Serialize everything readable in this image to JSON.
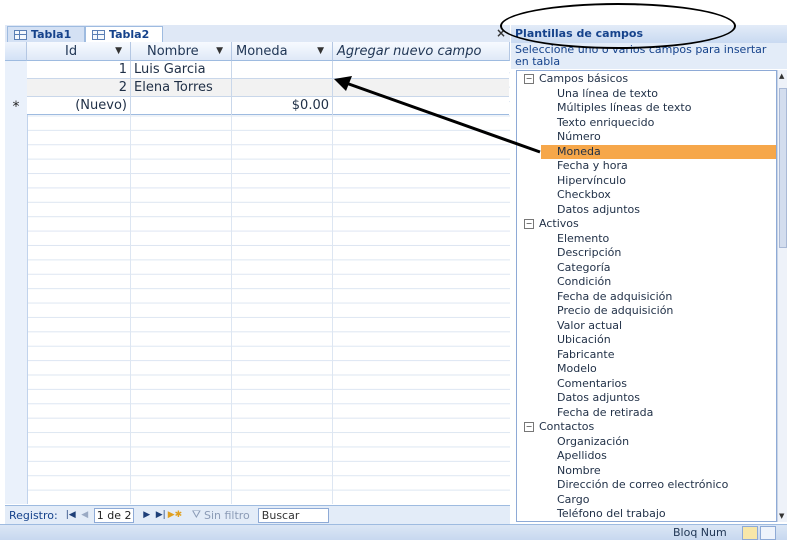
{
  "tabs": [
    {
      "label": "Tabla1"
    },
    {
      "label": "Tabla2"
    }
  ],
  "tab_close_glyph": "×",
  "datasheet": {
    "columns": [
      "Id",
      "Nombre",
      "Moneda",
      "Agregar nuevo campo"
    ],
    "rows": [
      {
        "id": "1",
        "nombre": "Luis Garcia",
        "moneda": ""
      },
      {
        "id": "2",
        "nombre": "Elena Torres",
        "moneda": ""
      }
    ],
    "new_row": {
      "marker": "*",
      "id": "(Nuevo)",
      "moneda": "$0.00"
    }
  },
  "record_nav": {
    "label": "Registro:",
    "current": "1 de 2",
    "filter_label": "Sin filtro",
    "search_placeholder": "Buscar"
  },
  "status": {
    "text": "Bloq Num"
  },
  "field_templates": {
    "title": "Plantillas de campos",
    "description": "Seleccione uno o varios campos para insertar en tabla",
    "groups": [
      {
        "name": "Campos básicos",
        "items": [
          "Una línea de texto",
          "Múltiples líneas de texto",
          "Texto enriquecido",
          "Número",
          "Moneda",
          "Fecha y hora",
          "Hipervínculo",
          "Checkbox",
          "Datos adjuntos"
        ]
      },
      {
        "name": "Activos",
        "items": [
          "Elemento",
          "Descripción",
          "Categoría",
          "Condición",
          "Fecha de adquisición",
          "Precio de adquisición",
          "Valor actual",
          "Ubicación",
          "Fabricante",
          "Modelo",
          "Comentarios",
          "Datos adjuntos",
          "Fecha de retirada"
        ]
      },
      {
        "name": "Contactos",
        "items": [
          "Organización",
          "Apellidos",
          "Nombre",
          "Dirección de correo electrónico",
          "Cargo",
          "Teléfono del trabajo"
        ]
      }
    ],
    "selected": "Moneda"
  },
  "colors": {
    "selected_item": "#f6a74a",
    "accent": "#15428b"
  }
}
